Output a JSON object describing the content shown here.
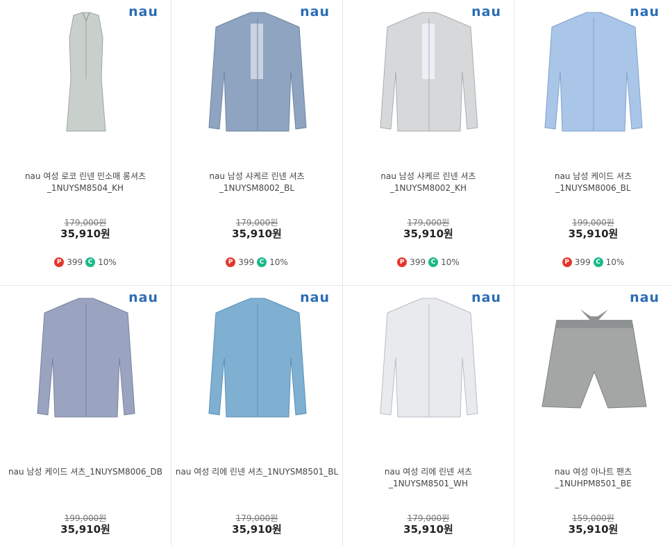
{
  "brand": "nau",
  "products": [
    {
      "title": "nau 여성 로코 린넨 민소매 롱셔츠\n_1NUYSM8504_KH",
      "original_price": "179,000원",
      "price": "35,910원",
      "point": "399",
      "coupon": "10%",
      "image": "sleeveless-long-shirt",
      "color": "#c9d0cc"
    },
    {
      "title": "nau 남성 샤케르 린넨 셔츠\n_1NUYSM8002_BL",
      "original_price": "179,000원",
      "price": "35,910원",
      "point": "399",
      "coupon": "10%",
      "image": "mens-linen-shirt",
      "color": "#8ea4c0"
    },
    {
      "title": "nau 남성 샤케르 린넨 셔츠\n_1NUYSM8002_KH",
      "original_price": "179,000원",
      "price": "35,910원",
      "point": "399",
      "coupon": "10%",
      "image": "mens-linen-shirt",
      "color": "#d6d8d9"
    },
    {
      "title": "nau 남성 케이드 셔츠_1NUYSM8006_BL",
      "original_price": "199,000원",
      "price": "35,910원",
      "point": "399",
      "coupon": "10%",
      "image": "mens-shirt",
      "color": "#a9c6e8"
    },
    {
      "title": "nau 남성 케이드 셔츠_1NUYSM8006_DB",
      "original_price": "199,000원",
      "price": "35,910원",
      "image": "mens-shirt",
      "color": "#9aa3bf"
    },
    {
      "title": "nau 여성 리에 린넨 셔츠_1NUYSM8501_BL",
      "original_price": "179,000원",
      "price": "35,910원",
      "image": "womens-linen-shirt",
      "color": "#7fb0d2"
    },
    {
      "title": "nau 여성 리에 린넨 셔츠\n_1NUYSM8501_WH",
      "original_price": "179,000원",
      "price": "35,910원",
      "image": "womens-linen-shirt",
      "color": "#e8eaee"
    },
    {
      "title": "nau 여성 아나트 팬츠_1NUHPM8501_BE",
      "original_price": "159,000원",
      "price": "35,910원",
      "image": "shorts",
      "color": "#a4a6a6"
    }
  ]
}
